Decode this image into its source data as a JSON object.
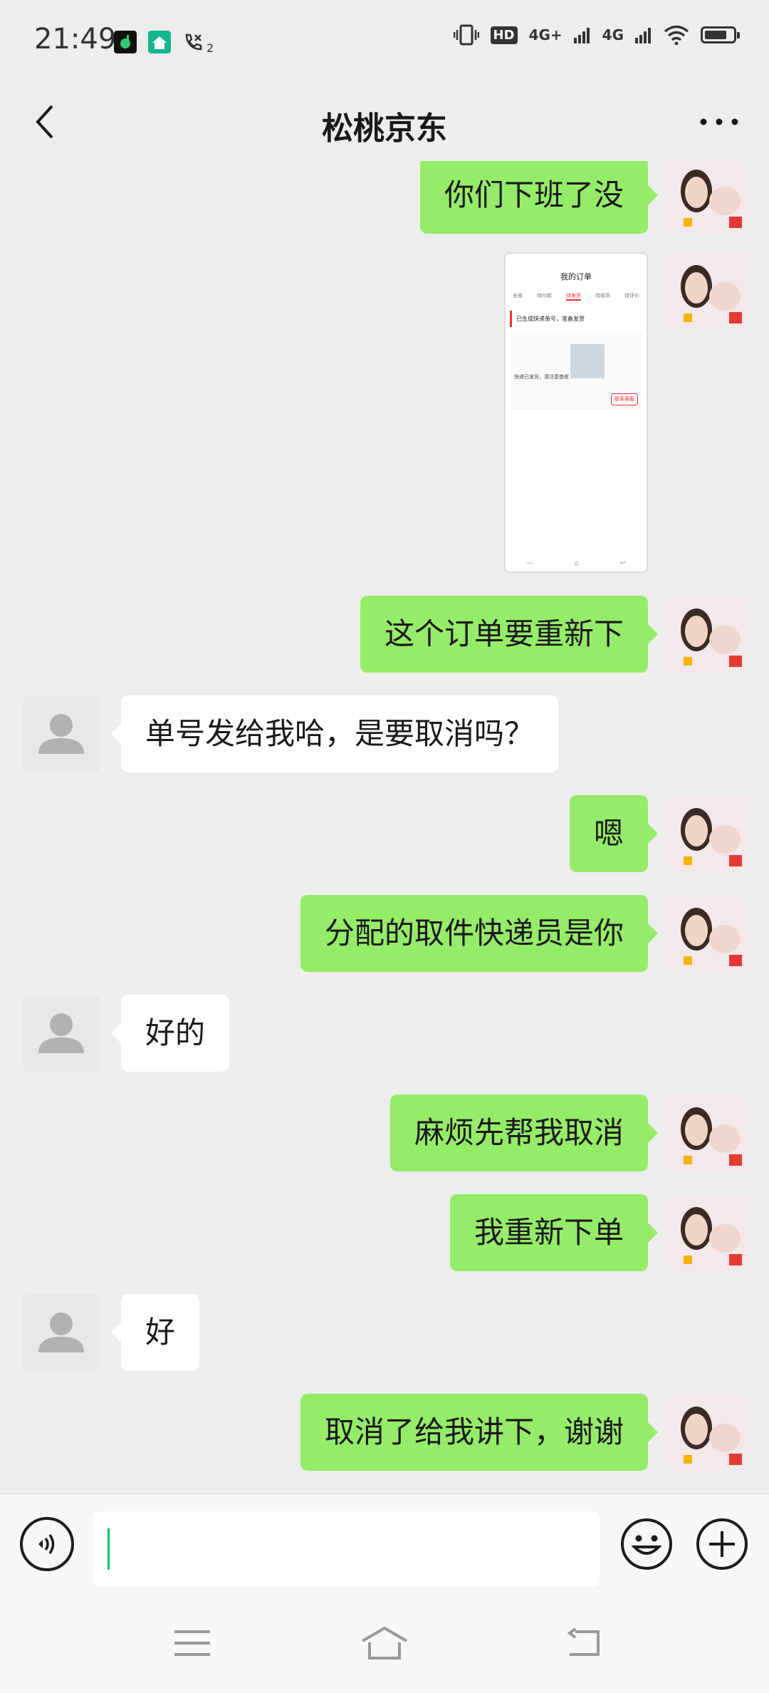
{
  "status_bar": {
    "time": "21:49",
    "left_icons": [
      "music-app-icon",
      "home-app-icon",
      "missed-call-icon"
    ],
    "call_count": "2",
    "hd_label": "HD",
    "net1": "4G+",
    "net2": "4G",
    "battery_level": 0.8
  },
  "header": {
    "title": "松桃京东"
  },
  "messages": [
    {
      "sender": "self",
      "type": "text",
      "text": "你们下班了没"
    },
    {
      "sender": "self",
      "type": "image",
      "image": {
        "title": "我的订单",
        "tabs": [
          "全部",
          "待付款",
          "待发货",
          "待收货",
          "待评价"
        ],
        "section": "已生成快递单号，准备发货",
        "card_text": "快递已发货，请注意查收",
        "button": "联系客服"
      }
    },
    {
      "sender": "self",
      "type": "text",
      "text": "这个订单要重新下"
    },
    {
      "sender": "other",
      "type": "text",
      "text": "单号发给我哈，是要取消吗？"
    },
    {
      "sender": "self",
      "type": "text",
      "text": "嗯"
    },
    {
      "sender": "self",
      "type": "text",
      "text": "分配的取件快递员是你"
    },
    {
      "sender": "other",
      "type": "text",
      "text": "好的"
    },
    {
      "sender": "self",
      "type": "text",
      "text": "麻烦先帮我取消"
    },
    {
      "sender": "self",
      "type": "text",
      "text": "我重新下单"
    },
    {
      "sender": "other",
      "type": "text",
      "text": "好"
    },
    {
      "sender": "self",
      "type": "text",
      "text": "取消了给我讲下，谢谢"
    }
  ],
  "input": {
    "value": "",
    "placeholder": ""
  },
  "colors": {
    "self_bubble": "#95ec69",
    "other_bubble": "#ffffff",
    "background": "#ededed",
    "caret": "#07c160"
  }
}
